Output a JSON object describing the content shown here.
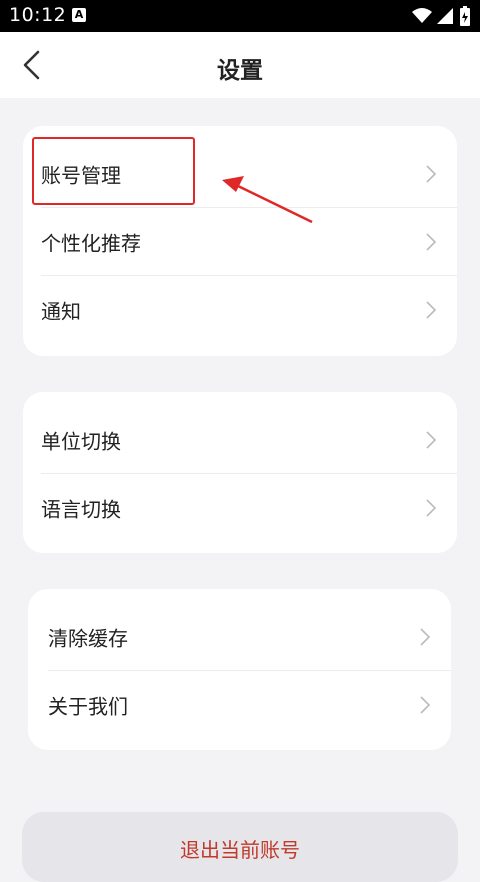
{
  "statusbar": {
    "time": "10:12",
    "badge": "A"
  },
  "nav": {
    "title": "设置"
  },
  "groups": [
    {
      "items": [
        {
          "label": "账号管理"
        },
        {
          "label": "个性化推荐"
        },
        {
          "label": "通知"
        }
      ]
    },
    {
      "items": [
        {
          "label": "单位切换"
        },
        {
          "label": "语言切换"
        }
      ]
    },
    {
      "items": [
        {
          "label": "清除缓存"
        },
        {
          "label": "关于我们"
        }
      ]
    }
  ],
  "logout": {
    "label": "退出当前账号"
  },
  "colors": {
    "accent": "#c0392b",
    "annotation": "#e02828"
  }
}
